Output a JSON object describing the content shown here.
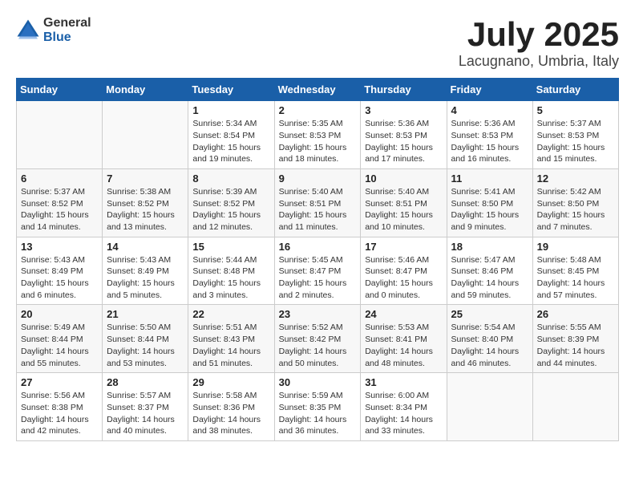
{
  "header": {
    "logo_general": "General",
    "logo_blue": "Blue",
    "month": "July 2025",
    "location": "Lacugnano, Umbria, Italy"
  },
  "weekdays": [
    "Sunday",
    "Monday",
    "Tuesday",
    "Wednesday",
    "Thursday",
    "Friday",
    "Saturday"
  ],
  "weeks": [
    [
      {
        "day": "",
        "detail": ""
      },
      {
        "day": "",
        "detail": ""
      },
      {
        "day": "1",
        "detail": "Sunrise: 5:34 AM\nSunset: 8:54 PM\nDaylight: 15 hours and 19 minutes."
      },
      {
        "day": "2",
        "detail": "Sunrise: 5:35 AM\nSunset: 8:53 PM\nDaylight: 15 hours and 18 minutes."
      },
      {
        "day": "3",
        "detail": "Sunrise: 5:36 AM\nSunset: 8:53 PM\nDaylight: 15 hours and 17 minutes."
      },
      {
        "day": "4",
        "detail": "Sunrise: 5:36 AM\nSunset: 8:53 PM\nDaylight: 15 hours and 16 minutes."
      },
      {
        "day": "5",
        "detail": "Sunrise: 5:37 AM\nSunset: 8:53 PM\nDaylight: 15 hours and 15 minutes."
      }
    ],
    [
      {
        "day": "6",
        "detail": "Sunrise: 5:37 AM\nSunset: 8:52 PM\nDaylight: 15 hours and 14 minutes."
      },
      {
        "day": "7",
        "detail": "Sunrise: 5:38 AM\nSunset: 8:52 PM\nDaylight: 15 hours and 13 minutes."
      },
      {
        "day": "8",
        "detail": "Sunrise: 5:39 AM\nSunset: 8:52 PM\nDaylight: 15 hours and 12 minutes."
      },
      {
        "day": "9",
        "detail": "Sunrise: 5:40 AM\nSunset: 8:51 PM\nDaylight: 15 hours and 11 minutes."
      },
      {
        "day": "10",
        "detail": "Sunrise: 5:40 AM\nSunset: 8:51 PM\nDaylight: 15 hours and 10 minutes."
      },
      {
        "day": "11",
        "detail": "Sunrise: 5:41 AM\nSunset: 8:50 PM\nDaylight: 15 hours and 9 minutes."
      },
      {
        "day": "12",
        "detail": "Sunrise: 5:42 AM\nSunset: 8:50 PM\nDaylight: 15 hours and 7 minutes."
      }
    ],
    [
      {
        "day": "13",
        "detail": "Sunrise: 5:43 AM\nSunset: 8:49 PM\nDaylight: 15 hours and 6 minutes."
      },
      {
        "day": "14",
        "detail": "Sunrise: 5:43 AM\nSunset: 8:49 PM\nDaylight: 15 hours and 5 minutes."
      },
      {
        "day": "15",
        "detail": "Sunrise: 5:44 AM\nSunset: 8:48 PM\nDaylight: 15 hours and 3 minutes."
      },
      {
        "day": "16",
        "detail": "Sunrise: 5:45 AM\nSunset: 8:47 PM\nDaylight: 15 hours and 2 minutes."
      },
      {
        "day": "17",
        "detail": "Sunrise: 5:46 AM\nSunset: 8:47 PM\nDaylight: 15 hours and 0 minutes."
      },
      {
        "day": "18",
        "detail": "Sunrise: 5:47 AM\nSunset: 8:46 PM\nDaylight: 14 hours and 59 minutes."
      },
      {
        "day": "19",
        "detail": "Sunrise: 5:48 AM\nSunset: 8:45 PM\nDaylight: 14 hours and 57 minutes."
      }
    ],
    [
      {
        "day": "20",
        "detail": "Sunrise: 5:49 AM\nSunset: 8:44 PM\nDaylight: 14 hours and 55 minutes."
      },
      {
        "day": "21",
        "detail": "Sunrise: 5:50 AM\nSunset: 8:44 PM\nDaylight: 14 hours and 53 minutes."
      },
      {
        "day": "22",
        "detail": "Sunrise: 5:51 AM\nSunset: 8:43 PM\nDaylight: 14 hours and 51 minutes."
      },
      {
        "day": "23",
        "detail": "Sunrise: 5:52 AM\nSunset: 8:42 PM\nDaylight: 14 hours and 50 minutes."
      },
      {
        "day": "24",
        "detail": "Sunrise: 5:53 AM\nSunset: 8:41 PM\nDaylight: 14 hours and 48 minutes."
      },
      {
        "day": "25",
        "detail": "Sunrise: 5:54 AM\nSunset: 8:40 PM\nDaylight: 14 hours and 46 minutes."
      },
      {
        "day": "26",
        "detail": "Sunrise: 5:55 AM\nSunset: 8:39 PM\nDaylight: 14 hours and 44 minutes."
      }
    ],
    [
      {
        "day": "27",
        "detail": "Sunrise: 5:56 AM\nSunset: 8:38 PM\nDaylight: 14 hours and 42 minutes."
      },
      {
        "day": "28",
        "detail": "Sunrise: 5:57 AM\nSunset: 8:37 PM\nDaylight: 14 hours and 40 minutes."
      },
      {
        "day": "29",
        "detail": "Sunrise: 5:58 AM\nSunset: 8:36 PM\nDaylight: 14 hours and 38 minutes."
      },
      {
        "day": "30",
        "detail": "Sunrise: 5:59 AM\nSunset: 8:35 PM\nDaylight: 14 hours and 36 minutes."
      },
      {
        "day": "31",
        "detail": "Sunrise: 6:00 AM\nSunset: 8:34 PM\nDaylight: 14 hours and 33 minutes."
      },
      {
        "day": "",
        "detail": ""
      },
      {
        "day": "",
        "detail": ""
      }
    ]
  ]
}
